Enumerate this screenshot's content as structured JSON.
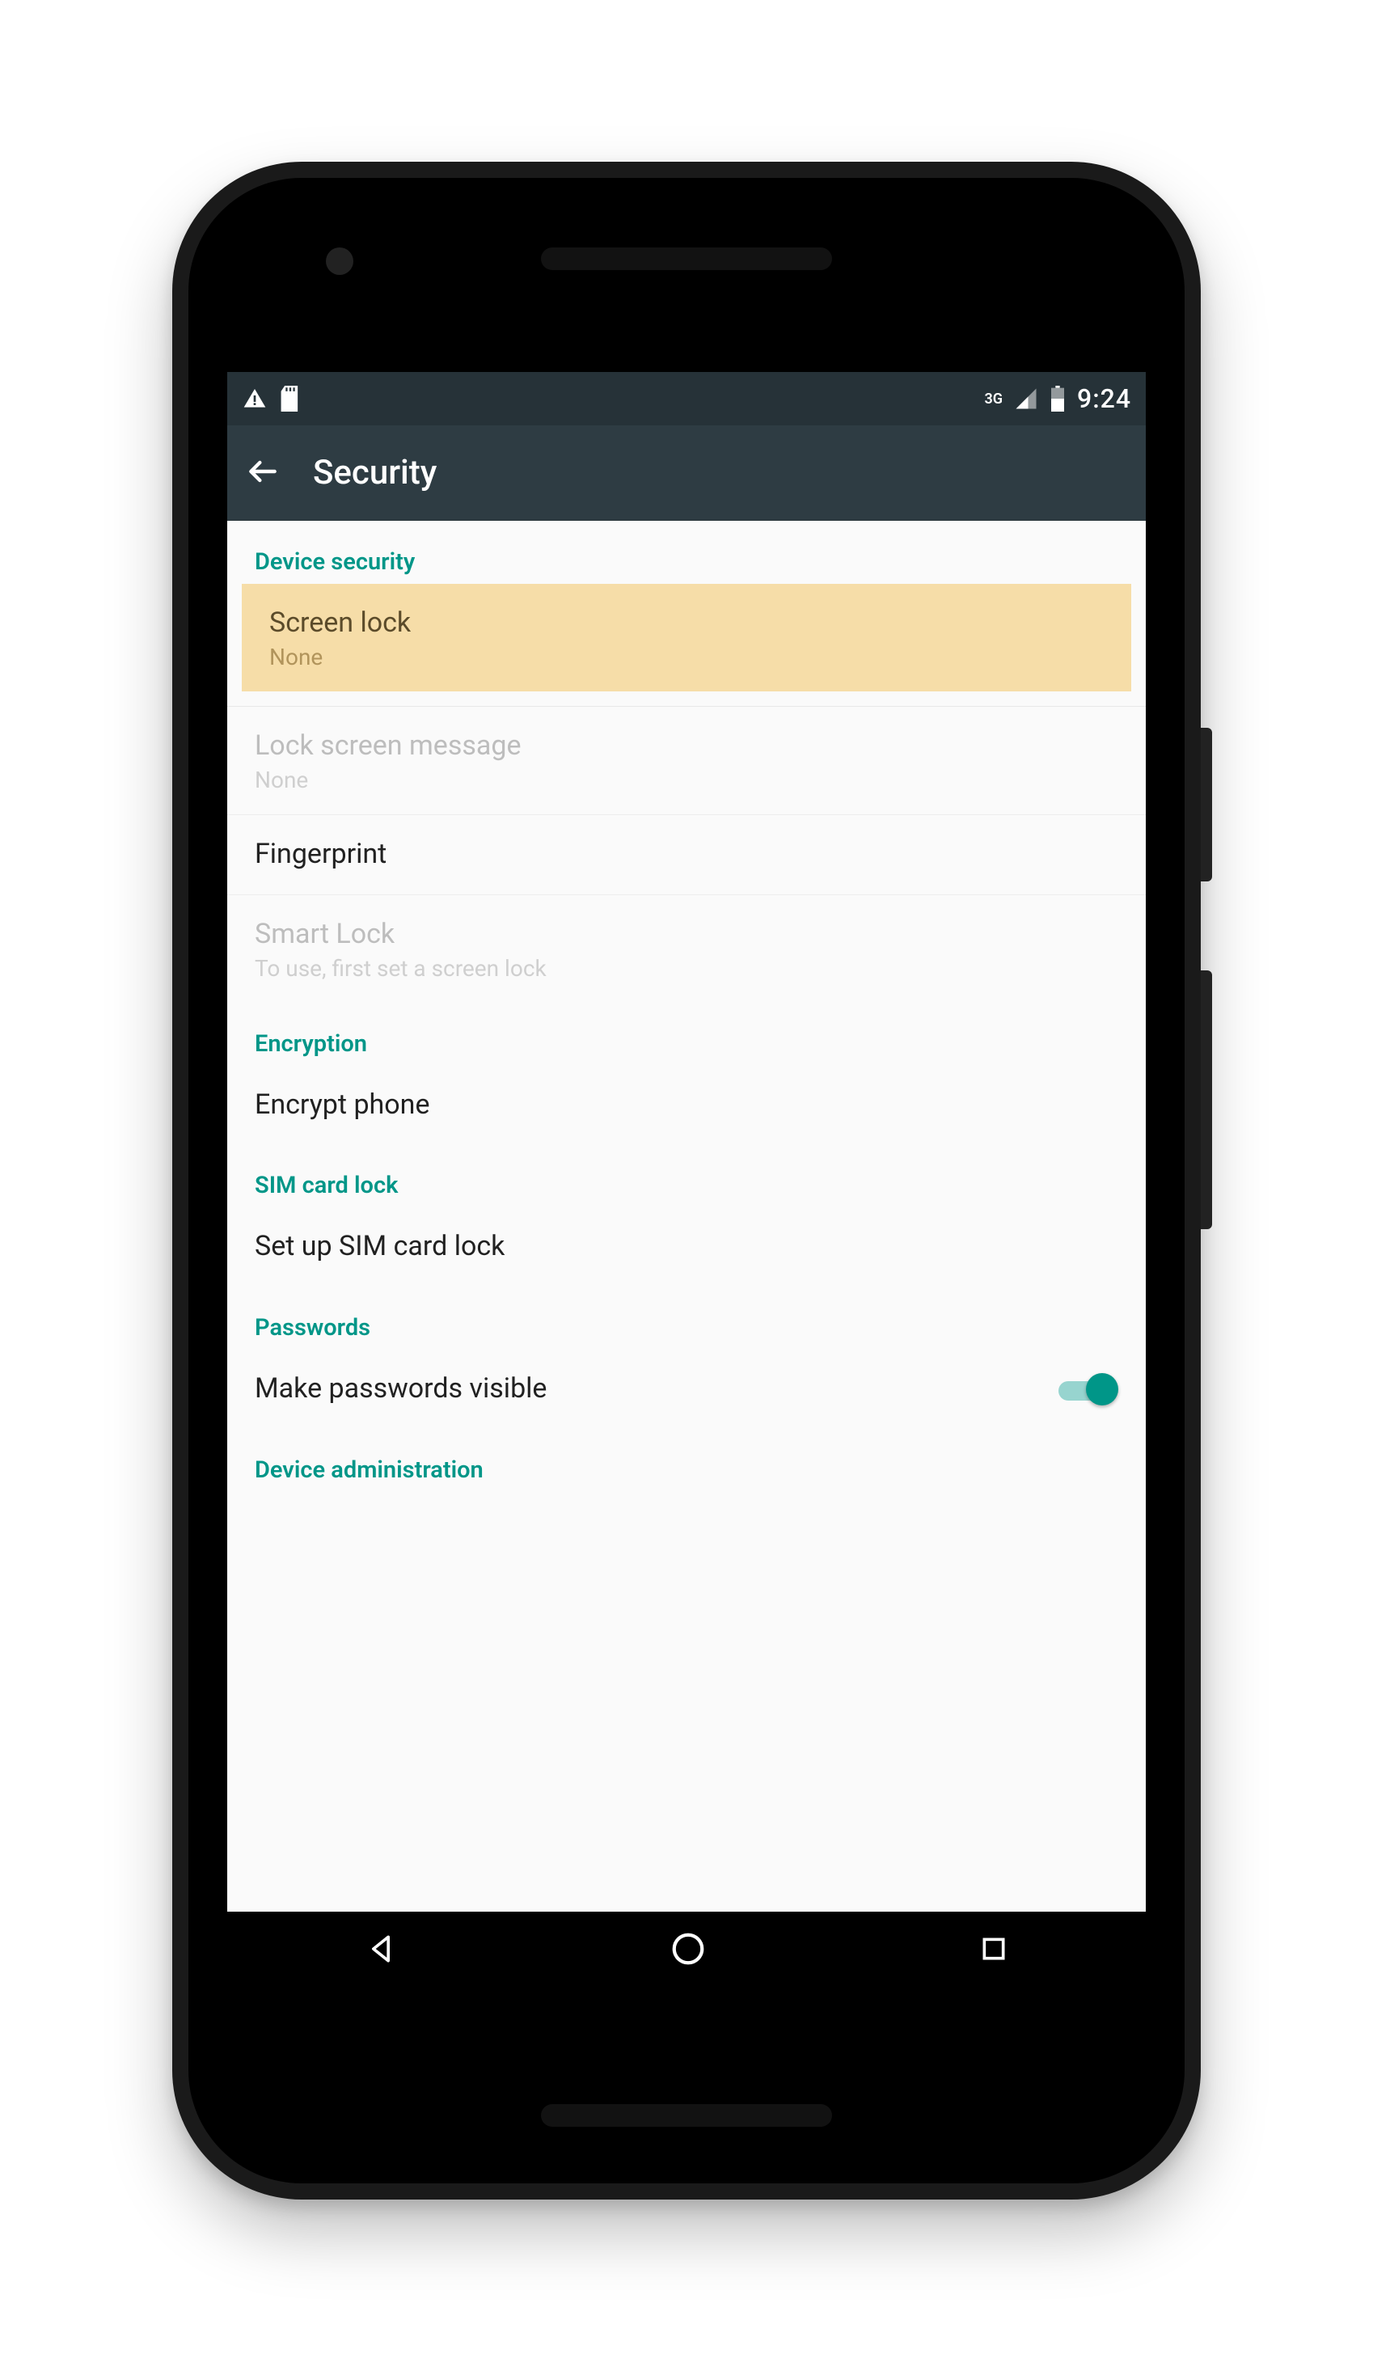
{
  "status": {
    "network_label": "3G",
    "time": "9:24"
  },
  "appbar": {
    "title": "Security"
  },
  "sections": {
    "device_security": {
      "header": "Device security",
      "screen_lock": {
        "title": "Screen lock",
        "value": "None"
      },
      "lock_msg": {
        "title": "Lock screen message",
        "value": "None"
      },
      "fingerprint": {
        "title": "Fingerprint"
      },
      "smart_lock": {
        "title": "Smart Lock",
        "value": "To use, first set a screen lock"
      }
    },
    "encryption": {
      "header": "Encryption",
      "encrypt_phone": {
        "title": "Encrypt phone"
      }
    },
    "sim": {
      "header": "SIM card lock",
      "setup": {
        "title": "Set up SIM card lock"
      }
    },
    "passwords": {
      "header": "Passwords",
      "visible": {
        "title": "Make passwords visible",
        "on": true
      }
    },
    "device_admin": {
      "header": "Device administration"
    }
  }
}
